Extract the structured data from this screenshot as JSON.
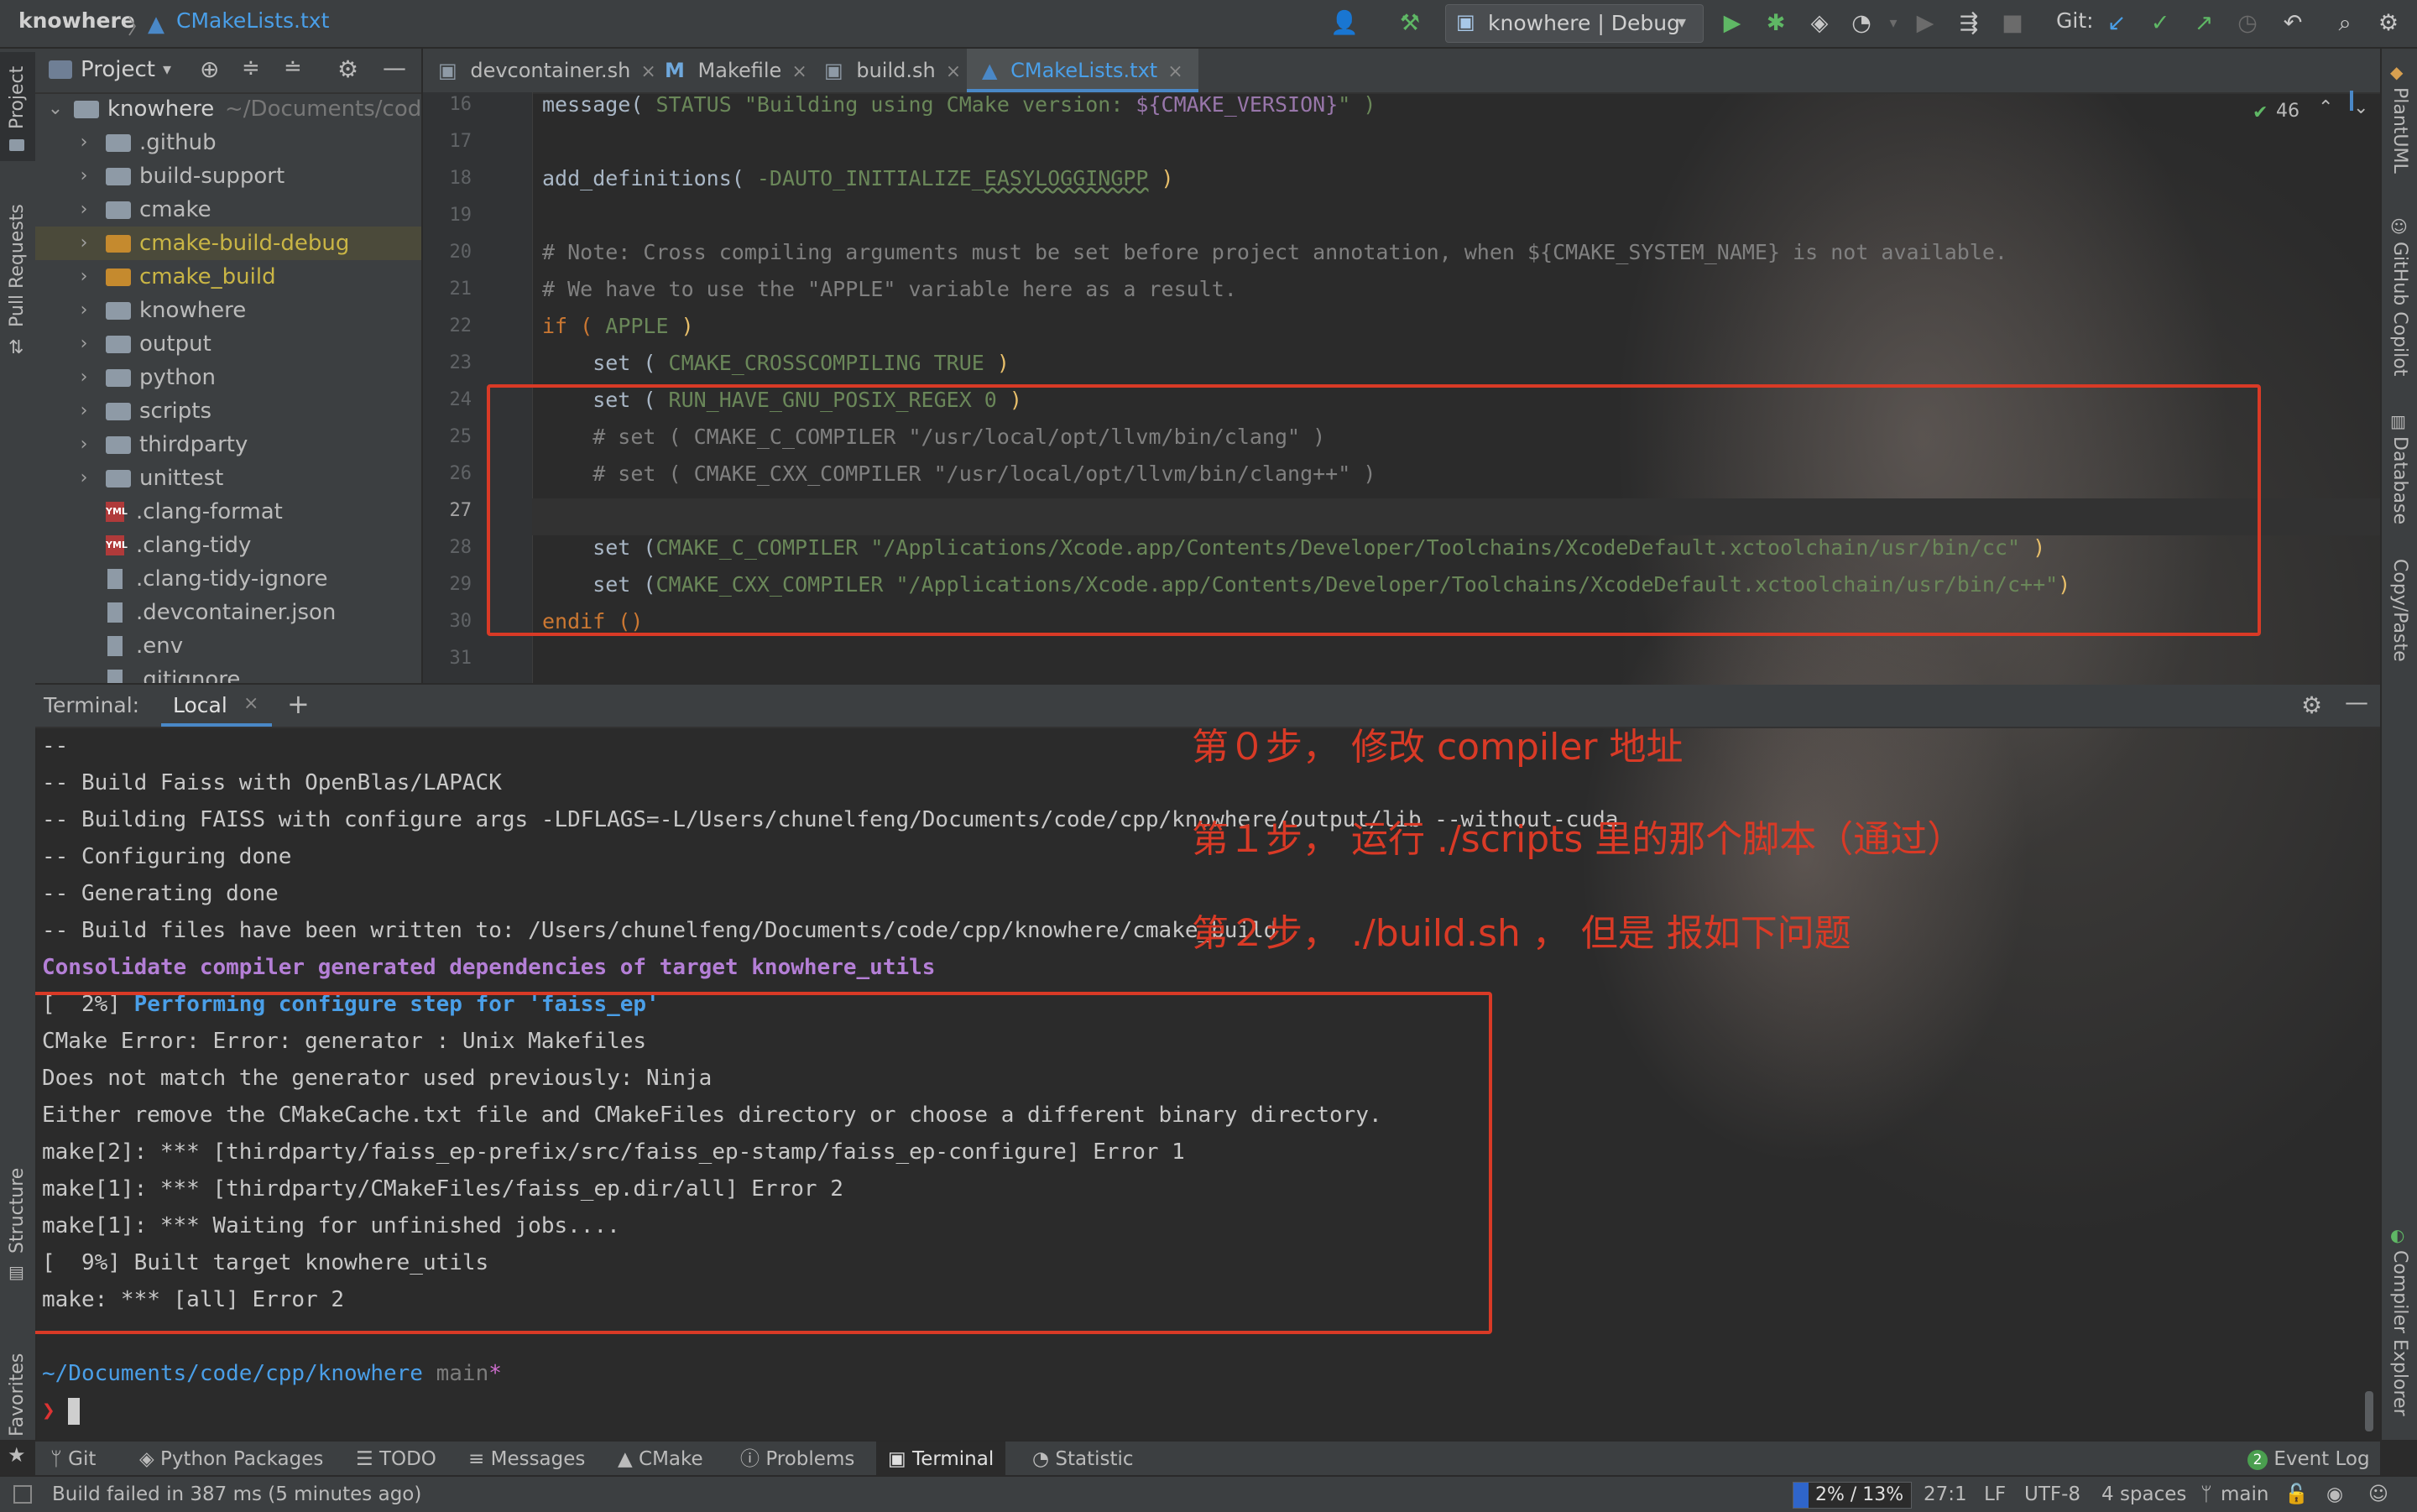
{
  "titlebar": {
    "project": "knowhere",
    "file": "CMakeLists.txt",
    "run_config": "knowhere | Debug",
    "git_label": "Git:"
  },
  "left_strip": {
    "project": "Project",
    "pull_requests": "Pull Requests",
    "structure": "Structure",
    "favorites": "Favorites"
  },
  "right_strip": {
    "plantuml": "PlantUML",
    "copilot": "GitHub Copilot",
    "database": "Database",
    "copy_paste": "Copy/Paste",
    "compiler_explorer": "Compiler Explorer"
  },
  "project_panel": {
    "title": "Project",
    "root": {
      "name": "knowhere",
      "path": "~/Documents/cod"
    },
    "items": [
      {
        "name": ".github",
        "kind": "folder"
      },
      {
        "name": "build-support",
        "kind": "folder"
      },
      {
        "name": "cmake",
        "kind": "folder"
      },
      {
        "name": "cmake-build-debug",
        "kind": "folder-excluded"
      },
      {
        "name": "cmake_build",
        "kind": "folder-excluded"
      },
      {
        "name": "knowhere",
        "kind": "folder"
      },
      {
        "name": "output",
        "kind": "folder"
      },
      {
        "name": "python",
        "kind": "folder"
      },
      {
        "name": "scripts",
        "kind": "folder"
      },
      {
        "name": "thirdparty",
        "kind": "folder"
      },
      {
        "name": "unittest",
        "kind": "folder"
      },
      {
        "name": ".clang-format",
        "kind": "yaml"
      },
      {
        "name": ".clang-tidy",
        "kind": "yaml"
      },
      {
        "name": ".clang-tidy-ignore",
        "kind": "file"
      },
      {
        "name": ".devcontainer.json",
        "kind": "json"
      },
      {
        "name": ".env",
        "kind": "file"
      },
      {
        "name": ".gitignore",
        "kind": "file"
      }
    ]
  },
  "editor_tabs": [
    {
      "label": "devcontainer.sh",
      "icon": "shell-file-icon"
    },
    {
      "label": "Makefile",
      "icon": "makefile-icon"
    },
    {
      "label": "build.sh",
      "icon": "shell-file-icon"
    },
    {
      "label": "CMakeLists.txt",
      "icon": "cmake-icon",
      "active": true
    }
  ],
  "editor": {
    "inspection_count": "46",
    "line_numbers": [
      "16",
      "17",
      "18",
      "19",
      "20",
      "21",
      "22",
      "23",
      "24",
      "25",
      "26",
      "27",
      "28",
      "29",
      "30",
      "31"
    ],
    "lines": {
      "l16": {
        "a": "message( ",
        "b": "STATUS ",
        "c": "\"Building using CMake version: ",
        "d": "${CMAKE_VERSION}",
        "e": "\" )"
      },
      "l18": {
        "a": "add_definitions( ",
        "b": "-DAUTO_INITIALIZE_",
        "c": "EASYLOGGINGPP",
        "d": " )"
      },
      "l20": "# Note: Cross compiling arguments must be set before project annotation, when ${CMAKE_SYSTEM_NAME} is not available.",
      "l21": "# We have to use the \"APPLE\" variable here as a result.",
      "l22": {
        "a": "if ( ",
        "b": "APPLE",
        "c": " )"
      },
      "l23": {
        "a": "    set ( ",
        "b": "CMAKE_CROSSCOMPILING TRUE",
        "c": " )"
      },
      "l24": {
        "a": "    set ( ",
        "b": "RUN_HAVE_GNU_POSIX_REGEX 0",
        "c": " )"
      },
      "l25": "    # set ( CMAKE_C_COMPILER \"/usr/local/opt/llvm/bin/clang\" )",
      "l26": "    # set ( CMAKE_CXX_COMPILER \"/usr/local/opt/llvm/bin/clang++\" )",
      "l28": {
        "a": "    set (",
        "b": "CMAKE_C_COMPILER ",
        "c": "\"/Applications/Xcode.app/Contents/Developer/Toolchains/XcodeDefault.xctoolchain/usr/bin/cc\"",
        "d": " )"
      },
      "l29": {
        "a": "    set (",
        "b": "CMAKE_CXX_COMPILER ",
        "c": "\"/Applications/Xcode.app/Contents/Developer/Toolchains/XcodeDefault.xctoolchain/usr/bin/c++\"",
        "d": ")"
      },
      "l30": "endif ()"
    }
  },
  "terminal": {
    "title": "Terminal:",
    "tab": "Local",
    "lines": [
      "--",
      "-- Build Faiss with OpenBlas/LAPACK",
      "-- Building FAISS with configure args -LDFLAGS=-L/Users/chunelfeng/Documents/code/cpp/knowhere/output/lib --without-cuda",
      "-- Configuring done",
      "-- Generating done",
      "-- Build files have been written to: /Users/chunelfeng/Documents/code/cpp/knowhere/cmake_build",
      "Consolidate compiler generated dependencies of target knowhere_utils",
      "[  2%] ",
      "Performing configure step for 'faiss_ep'",
      "CMake Error: Error: generator : Unix Makefiles",
      "Does not match the generator used previously: Ninja",
      "Either remove the CMakeCache.txt file and CMakeFiles directory or choose a different binary directory.",
      "make[2]: *** [thirdparty/faiss_ep-prefix/src/faiss_ep-stamp/faiss_ep-configure] Error 1",
      "make[1]: *** [thirdparty/CMakeFiles/faiss_ep.dir/all] Error 2",
      "make[1]: *** Waiting for unfinished jobs....",
      "[  9%] Built target knowhere_utils",
      "make: *** [all] Error 2"
    ],
    "prompt_path": "~/Documents/code/cpp/knowhere",
    "prompt_branch": "main",
    "prompt_star": "*",
    "prompt_symbol": "❯"
  },
  "annotations": [
    "第０步， 修改 compiler 地址",
    "第１步， 运行 ./scripts 里的那个脚本（通过）",
    "第２步， ./build.sh ， 但是 报如下问题"
  ],
  "tool_tabs": [
    {
      "label": "Git",
      "icon": "git-branch-icon"
    },
    {
      "label": "Python Packages",
      "icon": "packages-icon"
    },
    {
      "label": "TODO",
      "icon": "todo-list-icon"
    },
    {
      "label": "Messages",
      "icon": "messages-icon"
    },
    {
      "label": "CMake",
      "icon": "cmake-triangle-icon"
    },
    {
      "label": "Problems",
      "icon": "info-icon"
    },
    {
      "label": "Terminal",
      "icon": "terminal-icon",
      "active": true
    },
    {
      "label": "Statistic",
      "icon": "statistic-icon"
    }
  ],
  "event_log": {
    "count": "2",
    "label": "Event Log"
  },
  "statusbar": {
    "message": "Build failed in 387 ms (5 minutes ago)",
    "progress": "2% / 13%",
    "progress_fraction": 0.13,
    "caret": "27:1",
    "line_sep": "LF",
    "encoding": "UTF-8",
    "indent": "4 spaces",
    "branch": "main"
  },
  "colors": {
    "accent": "#4a88c7",
    "annotation_red": "#d93a26",
    "run_green": "#5fb865"
  }
}
